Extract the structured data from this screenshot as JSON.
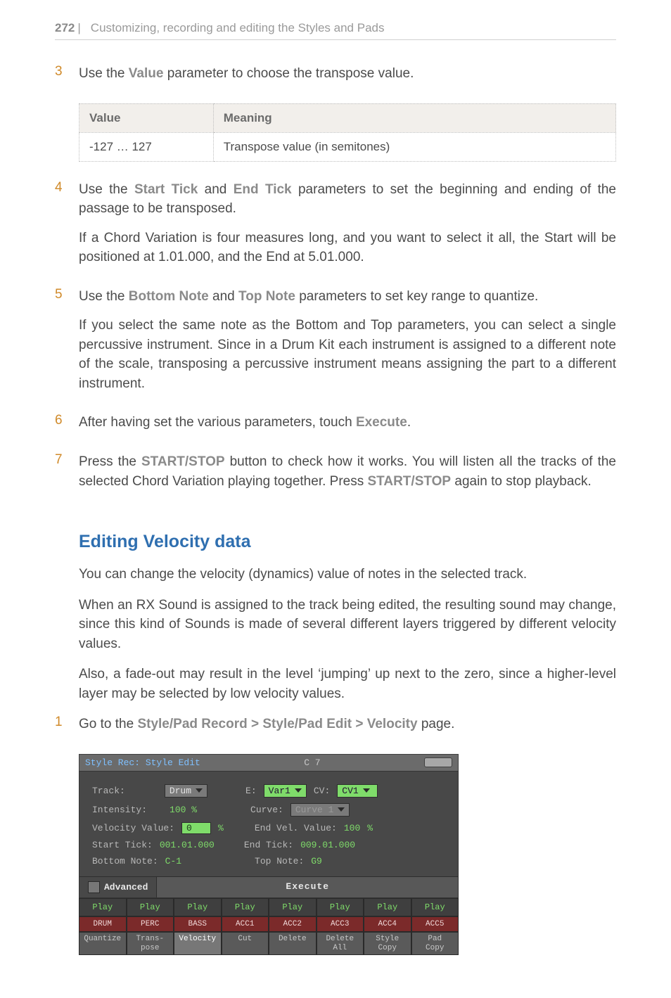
{
  "header": {
    "page_number": "272",
    "separator": "|",
    "title": "Customizing, recording and editing the Styles and Pads"
  },
  "steps": [
    {
      "num": "3",
      "paragraphs": [
        [
          {
            "t": "plain",
            "v": "Use the "
          },
          {
            "t": "term",
            "v": "Value"
          },
          {
            "t": "plain",
            "v": " parameter to choose the transpose value."
          }
        ]
      ]
    },
    {
      "num": "4",
      "paragraphs": [
        [
          {
            "t": "plain",
            "v": "Use the "
          },
          {
            "t": "term",
            "v": "Start Tick"
          },
          {
            "t": "plain",
            "v": " and "
          },
          {
            "t": "term",
            "v": "End Tick"
          },
          {
            "t": "plain",
            "v": " parameters to set the beginning and ending of the passage to be transposed."
          }
        ],
        [
          {
            "t": "plain",
            "v": "If a Chord Variation is four measures long, and you want to select it all, the Start will be positioned at 1.01.000, and the End at 5.01.000."
          }
        ]
      ]
    },
    {
      "num": "5",
      "paragraphs": [
        [
          {
            "t": "plain",
            "v": "Use the "
          },
          {
            "t": "term",
            "v": "Bottom Note"
          },
          {
            "t": "plain",
            "v": " and "
          },
          {
            "t": "term",
            "v": "Top Note"
          },
          {
            "t": "plain",
            "v": " parameters to set key range to quantize."
          }
        ],
        [
          {
            "t": "plain",
            "v": "If you select the same note as the Bottom and Top parameters, you can select a single percussive instrument. Since in a Drum Kit each instrument is assigned to a different note of the scale, transposing a percussive instrument means assigning the part to a different instrument."
          }
        ]
      ]
    },
    {
      "num": "6",
      "paragraphs": [
        [
          {
            "t": "plain",
            "v": "After having set the various parameters, touch "
          },
          {
            "t": "term",
            "v": "Execute"
          },
          {
            "t": "plain",
            "v": "."
          }
        ]
      ]
    },
    {
      "num": "7",
      "paragraphs": [
        [
          {
            "t": "plain",
            "v": "Press the "
          },
          {
            "t": "term",
            "v": "START/STOP"
          },
          {
            "t": "plain",
            "v": " button to check how it works. You will listen all the tracks of the selected Chord Variation playing together. Press "
          },
          {
            "t": "term",
            "v": "START/STOP"
          },
          {
            "t": "plain",
            "v": " again to stop playback."
          }
        ]
      ]
    }
  ],
  "table": {
    "headers": {
      "value": "Value",
      "meaning": "Meaning"
    },
    "rows": [
      {
        "value": "-127 … 127",
        "meaning": "Transpose value (in semitones)"
      }
    ]
  },
  "section": {
    "title": "Editing Velocity data",
    "paragraphs": [
      "You can change the velocity (dynamics) value of notes in the selected track.",
      "When an RX Sound is assigned to the track being edited, the resulting sound may change, since this kind of Sounds is made of several different layers triggered by different velocity values.",
      "Also, a fade-out may result in the level ‘jumping’ up next to the zero, since a higher-level layer may be selected by low velocity values."
    ]
  },
  "section_step": {
    "num": "1",
    "paragraphs": [
      [
        {
          "t": "plain",
          "v": "Go to the "
        },
        {
          "t": "term",
          "v": "Style/Pad Record > Style/Pad Edit > Velocity"
        },
        {
          "t": "plain",
          "v": " page."
        }
      ]
    ]
  },
  "device": {
    "title_left": "Style Rec: Style Edit",
    "title_center": "C 7",
    "body": {
      "track_label": "Track:",
      "track_value": "Drum",
      "e_label": "E:",
      "e_value": "Var1",
      "cv_label": "CV:",
      "cv_value": "CV1",
      "intensity_label": "Intensity:",
      "intensity_value": "100 %",
      "curve_label": "Curve:",
      "curve_value": "Curve 1",
      "vel_value_label": "Velocity Value:",
      "vel_value_value": "0",
      "vel_value_unit": "%",
      "end_vel_label": "End Vel. Value:",
      "end_vel_value": "100",
      "end_vel_unit": "%",
      "start_tick_label": "Start Tick:",
      "start_tick_value": "001.01.000",
      "end_tick_label": "End Tick:",
      "end_tick_value": "009.01.000",
      "bottom_note_label": "Bottom Note:",
      "bottom_note_value": "C-1",
      "top_note_label": "Top Note:",
      "top_note_value": "G9",
      "advanced_label": "Advanced",
      "execute_label": "Execute"
    },
    "plays": [
      "Play",
      "Play",
      "Play",
      "Play",
      "Play",
      "Play",
      "Play",
      "Play"
    ],
    "tracks": [
      "DRUM",
      "PERC",
      "BASS",
      "ACC1",
      "ACC2",
      "ACC3",
      "ACC4",
      "ACC5"
    ],
    "tabs": [
      "Quantize",
      "Trans-\npose",
      "Velocity",
      "Cut",
      "Delete",
      "Delete\nAll",
      "Style\nCopy",
      "Pad\nCopy"
    ],
    "active_tab_index": 2
  }
}
